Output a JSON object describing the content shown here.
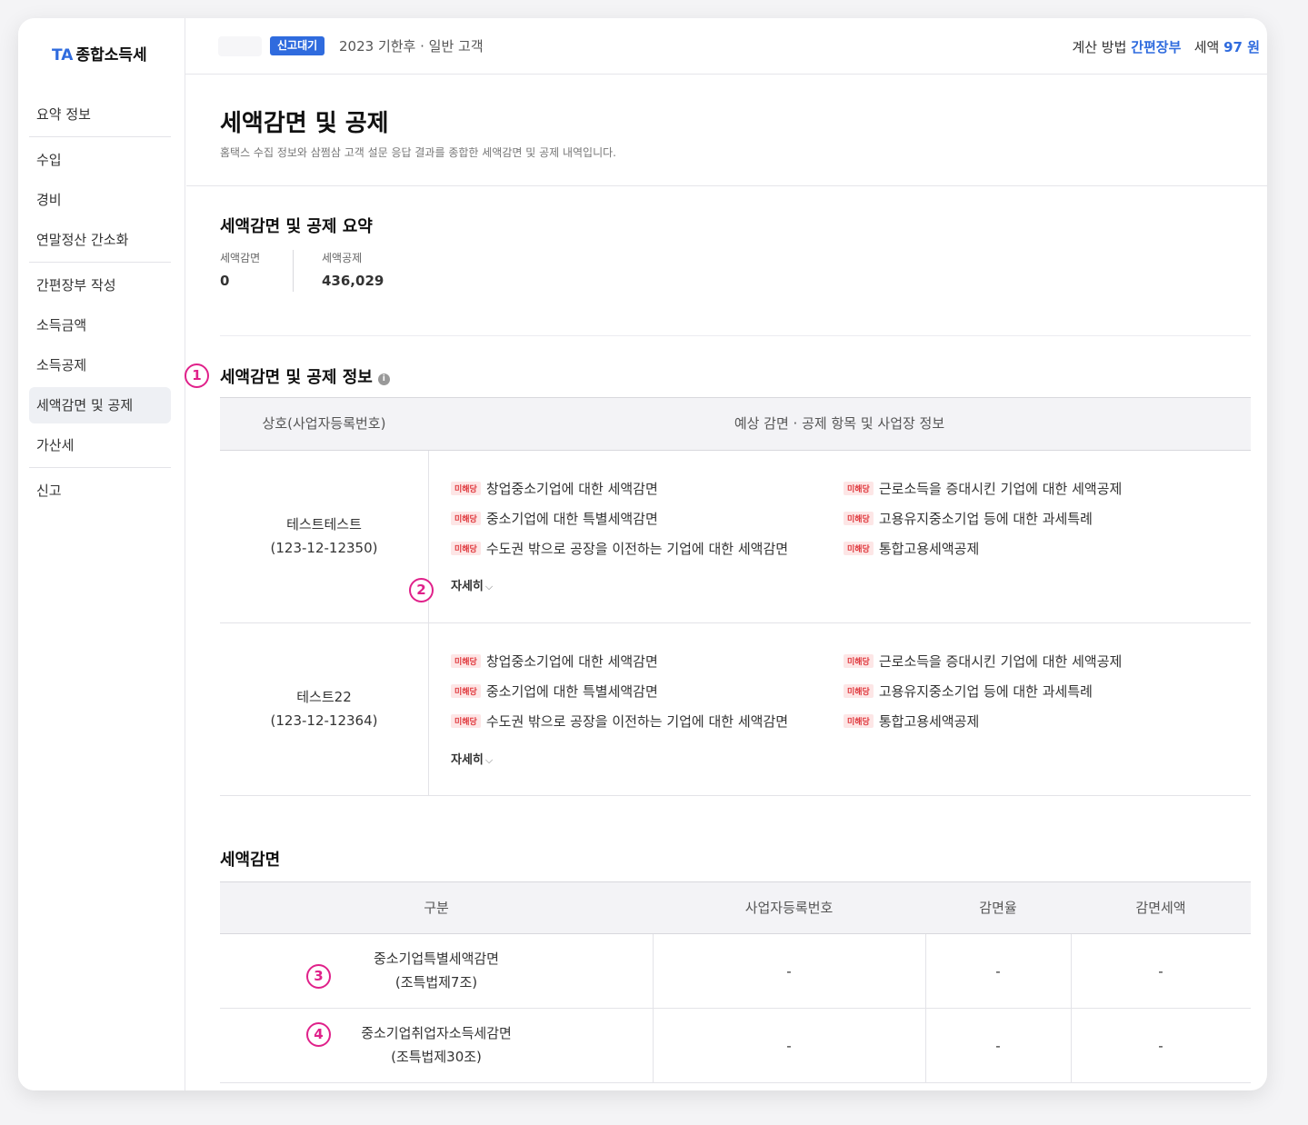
{
  "app": {
    "logo_prefix": "TA",
    "logo_name": "종합소득세"
  },
  "sidebar": {
    "items": [
      {
        "label": "요약 정보"
      },
      {
        "label": "수입"
      },
      {
        "label": "경비"
      },
      {
        "label": "연말정산 간소화"
      },
      {
        "label": "간편장부 작성"
      },
      {
        "label": "소득금액"
      },
      {
        "label": "소득공제"
      },
      {
        "label": "세액감면 및 공제",
        "active": true
      },
      {
        "label": "가산세"
      },
      {
        "label": "신고"
      }
    ]
  },
  "topbar": {
    "status": "신고대기",
    "meta": "2023 기한후 · 일반 고객",
    "calc_label": "계산 방법",
    "calc_value": "간편장부",
    "tax_label": "세액",
    "tax_value": "97 원"
  },
  "page": {
    "title": "세액감면 및 공제",
    "description": "홈택스 수집 정보와 삼쩜삼 고객 설문 응답 결과를 종합한 세액감면 및 공제 내역입니다."
  },
  "summary": {
    "title": "세액감면 및 공제 요약",
    "reduction_label": "세액감면",
    "reduction_value": "0",
    "deduction_label": "세액공제",
    "deduction_value": "436,029"
  },
  "info_section": {
    "title": "세액감면 및 공제 정보",
    "info_icon": "i",
    "columns": [
      "상호(사업자등록번호)",
      "예상 감면 · 공제 항목 및 사업장 정보"
    ],
    "tag": "미해당",
    "more_label": "자세히",
    "chevron": "⌵",
    "rows": [
      {
        "name": "테스트테스트",
        "biz_no": "(123-12-12350)",
        "items_left": [
          "창업중소기업에 대한 세액감면",
          "중소기업에 대한 특별세액감면",
          "수도권 밖으로 공장을 이전하는 기업에 대한 세액감면"
        ],
        "items_right": [
          "근로소득을 증대시킨 기업에 대한 세액공제",
          "고용유지중소기업 등에 대한 과세특례",
          "통합고용세액공제"
        ]
      },
      {
        "name": "테스트22",
        "biz_no": "(123-12-12364)",
        "items_left": [
          "창업중소기업에 대한 세액감면",
          "중소기업에 대한 특별세액감면",
          "수도권 밖으로 공장을 이전하는 기업에 대한 세액감면"
        ],
        "items_right": [
          "근로소득을 증대시킨 기업에 대한 세액공제",
          "고용유지중소기업 등에 대한 과세특례",
          "통합고용세액공제"
        ]
      }
    ]
  },
  "reduction_table": {
    "title": "세액감면",
    "columns": [
      "구분",
      "사업자등록번호",
      "감면율",
      "감면세액"
    ],
    "rows": [
      {
        "name": "중소기업특별세액감면",
        "law": "(조특법제7조)",
        "biz_no": "-",
        "rate": "-",
        "amount": "-"
      },
      {
        "name": "중소기업취업자소득세감면",
        "law": "(조특법제30조)",
        "biz_no": "-",
        "rate": "-",
        "amount": "-"
      }
    ]
  },
  "markers": [
    "1",
    "2",
    "3",
    "4"
  ],
  "colors": {
    "accent": "#2f6bde",
    "marker": "#e0218a",
    "tag_bg": "#fde6e6",
    "tag_text": "#e0393e"
  }
}
